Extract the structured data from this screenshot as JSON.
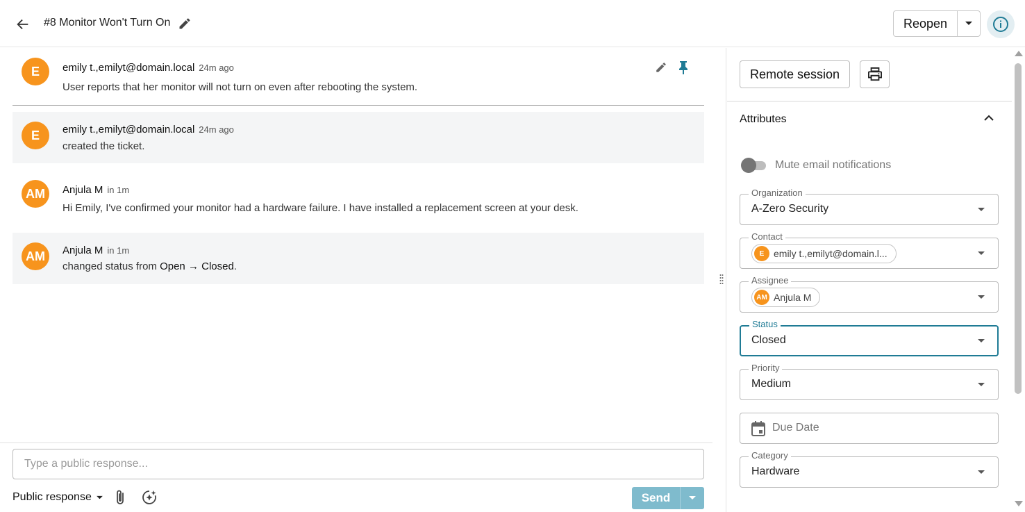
{
  "header": {
    "title": "#8 Monitor Won't Turn On",
    "reopen_label": "Reopen"
  },
  "conversation": {
    "messages": [
      {
        "initial": "E",
        "author": "emily t.,emilyt@domain.local",
        "time": "24m ago",
        "text": "User reports that her monitor will not turn on even after rebooting the system."
      },
      {
        "initial": "E",
        "author": "emily t.,emilyt@domain.local",
        "time": "24m ago",
        "text": "created the ticket."
      },
      {
        "initial": "AM",
        "author": "Anjula M",
        "time": "in 1m",
        "text": "Hi Emily, I've confirmed your monitor had a hardware failure. I have installed a replacement screen at your desk."
      },
      {
        "initial": "AM",
        "author": "Anjula M",
        "time": "in 1m",
        "text_prefix": "changed status from ",
        "from_status": "Open",
        "arrow": "→",
        "to_status": "Closed",
        "text_suffix": "."
      }
    ]
  },
  "composer": {
    "placeholder": "Type a public response...",
    "response_type": "Public response",
    "send_label": "Send"
  },
  "side_panel": {
    "remote_session_label": "Remote session",
    "attributes_title": "Attributes",
    "mute_label": "Mute email notifications",
    "mute_enabled": false,
    "fields": {
      "organization": {
        "label": "Organization",
        "value": "A-Zero Security"
      },
      "contact": {
        "label": "Contact",
        "initial": "E",
        "value": "emily t.,emilyt@domain.l..."
      },
      "assignee": {
        "label": "Assignee",
        "initial": "AM",
        "value": "Anjula M"
      },
      "status": {
        "label": "Status",
        "value": "Closed"
      },
      "priority": {
        "label": "Priority",
        "value": "Medium"
      },
      "due_date": {
        "placeholder": "Due Date"
      },
      "category": {
        "label": "Category",
        "value": "Hardware"
      }
    }
  },
  "colors": {
    "avatar": "#f7941d",
    "accent": "#1f7b95",
    "send_button": "#7fbbcd",
    "pin": "#1f7b95"
  }
}
